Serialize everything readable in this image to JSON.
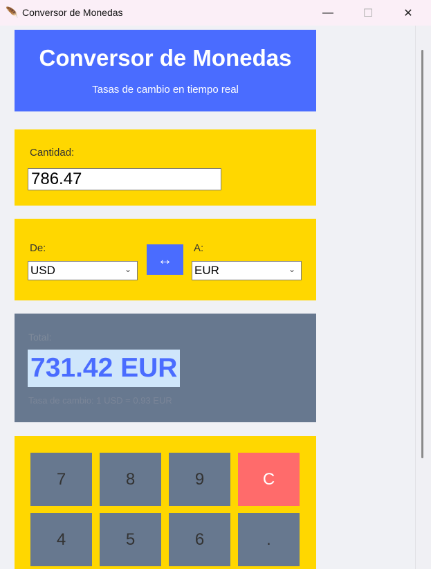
{
  "window": {
    "title": "Conversor de Monedas",
    "minimize_glyph": "—",
    "maximize_glyph": "☐",
    "close_glyph": "✕"
  },
  "header": {
    "title": "Conversor de Monedas",
    "subtitle": "Tasas de cambio en tiempo real"
  },
  "amount": {
    "label": "Cantidad:",
    "value": "786.47"
  },
  "currency": {
    "from_label": "De:",
    "from_value": "USD",
    "to_label": "A:",
    "to_value": "EUR",
    "swap_glyph": "↔",
    "chevron_glyph": "⌄"
  },
  "result": {
    "label": "Total:",
    "value": "731.42 EUR",
    "rate_text": "Tasa de cambio: 1 USD = 0.93 EUR"
  },
  "keypad": {
    "keys": [
      "7",
      "8",
      "9",
      "C",
      "4",
      "5",
      "6",
      "."
    ]
  },
  "colors": {
    "header_bg": "#4a6cff",
    "panel_yellow": "#ffd700",
    "key_gray": "#67788f",
    "clear_red": "#ff6b6b"
  }
}
